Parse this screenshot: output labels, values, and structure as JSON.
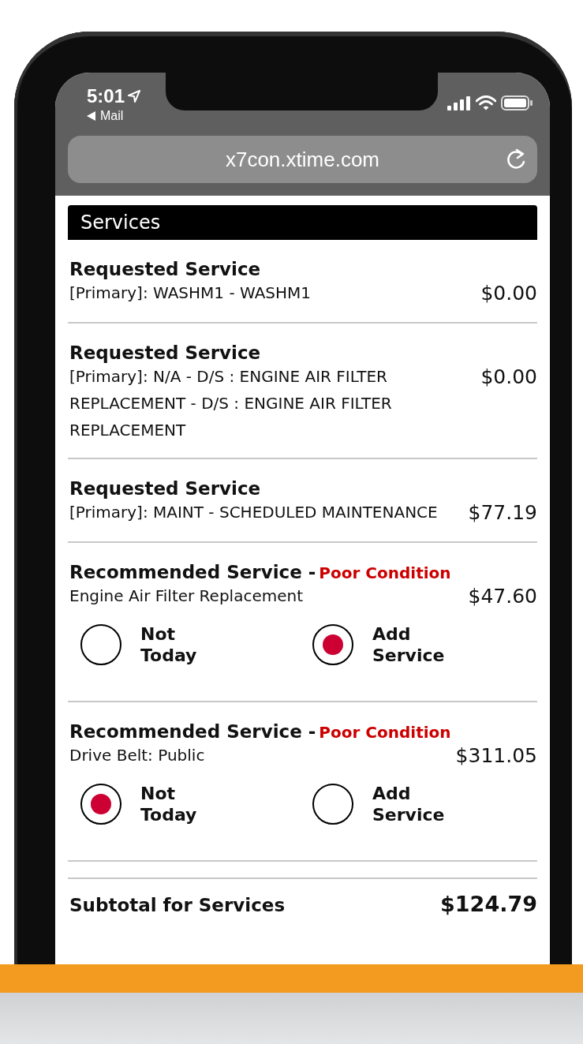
{
  "status_bar": {
    "time": "5:01",
    "back_label": "Mail"
  },
  "address_bar": {
    "url": "x7con.xtime.com"
  },
  "section": {
    "title": "Services"
  },
  "services": [
    {
      "kind": "requested",
      "title": "Requested Service",
      "description": "[Primary]: WASHM1 - WASHM1",
      "price": "$0.00"
    },
    {
      "kind": "requested",
      "title": "Requested Service",
      "description": "[Primary]: N/A - D/S : ENGINE AIR FILTER REPLACEMENT - D/S : ENGINE AIR FILTER REPLACEMENT",
      "price": "$0.00"
    },
    {
      "kind": "requested",
      "title": "Requested Service",
      "description": "[Primary]: MAINT - SCHEDULED MAINTENANCE",
      "price": "$77.19"
    },
    {
      "kind": "recommended",
      "title": "Recommended Service -",
      "condition": "Poor Condition",
      "description": "Engine Air Filter Replacement",
      "price": "$47.60",
      "options": [
        {
          "label": "Not Today",
          "selected": false
        },
        {
          "label": "Add Service",
          "selected": true
        }
      ]
    },
    {
      "kind": "recommended",
      "title": "Recommended Service -",
      "condition": "Poor Condition",
      "description": "Drive Belt: Public",
      "price": "$311.05",
      "options": [
        {
          "label": "Not Today",
          "selected": true
        },
        {
          "label": "Add Service",
          "selected": false
        }
      ]
    }
  ],
  "subtotal": {
    "label": "Subtotal for Services",
    "amount": "$124.79"
  }
}
